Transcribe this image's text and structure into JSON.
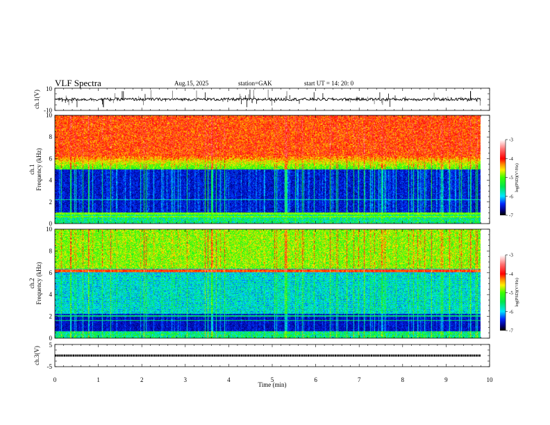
{
  "header": {
    "title": "VLF  Spectra",
    "date": "Aug.15, 2025",
    "station": "station=GAK",
    "start": "start  UT  =   14: 20: 0"
  },
  "chart_data": [
    {
      "type": "line",
      "panel": "ch1",
      "ylabel": "ch.1(V)",
      "ylim": [
        -10,
        10
      ],
      "yticks": [
        "10",
        "-10"
      ],
      "xlim": [
        0,
        10
      ],
      "data_end_min": 9.8,
      "baseline": 0,
      "description_color": "#000000"
    },
    {
      "type": "heatmap",
      "panel": "ch1-spectrogram",
      "ylabel": "ch.1\nFrequency  (kHz)",
      "ylabel_lines": [
        "ch.1",
        "Frequency  (kHz)"
      ],
      "ylim": [
        0,
        10
      ],
      "yticks": [
        "0",
        "2",
        "4",
        "6",
        "8",
        "10"
      ],
      "xlim": [
        0,
        10
      ],
      "colorbar": {
        "label": "log(PSD)(V²/Hz)",
        "range": [
          -7,
          -3
        ],
        "ticks": [
          "-3",
          "-4",
          "-5",
          "-6",
          "-7"
        ]
      }
    },
    {
      "type": "heatmap",
      "panel": "ch2-spectrogram",
      "ylabel_lines": [
        "ch.2",
        "Frequency  (kHz)"
      ],
      "ylim": [
        0,
        10
      ],
      "yticks": [
        "0",
        "2",
        "4",
        "6",
        "8",
        "10"
      ],
      "xlim": [
        0,
        10
      ],
      "colorbar": {
        "label": "log(PSD)(V²/Hz)",
        "range": [
          -7,
          -3
        ],
        "ticks": [
          "-3",
          "-4",
          "-5",
          "-6",
          "-7"
        ]
      }
    },
    {
      "type": "line",
      "panel": "ch3",
      "ylabel": "ch.3(V)",
      "ylim": [
        -5,
        5
      ],
      "yticks": [
        "5",
        "-5"
      ],
      "xlim": [
        0,
        10
      ],
      "data_end_min": 9.8,
      "baseline": 0
    }
  ],
  "xaxis": {
    "label": "Time  (min)",
    "ticks": [
      "0",
      "1",
      "2",
      "3",
      "4",
      "5",
      "6",
      "7",
      "8",
      "9",
      "10"
    ]
  }
}
